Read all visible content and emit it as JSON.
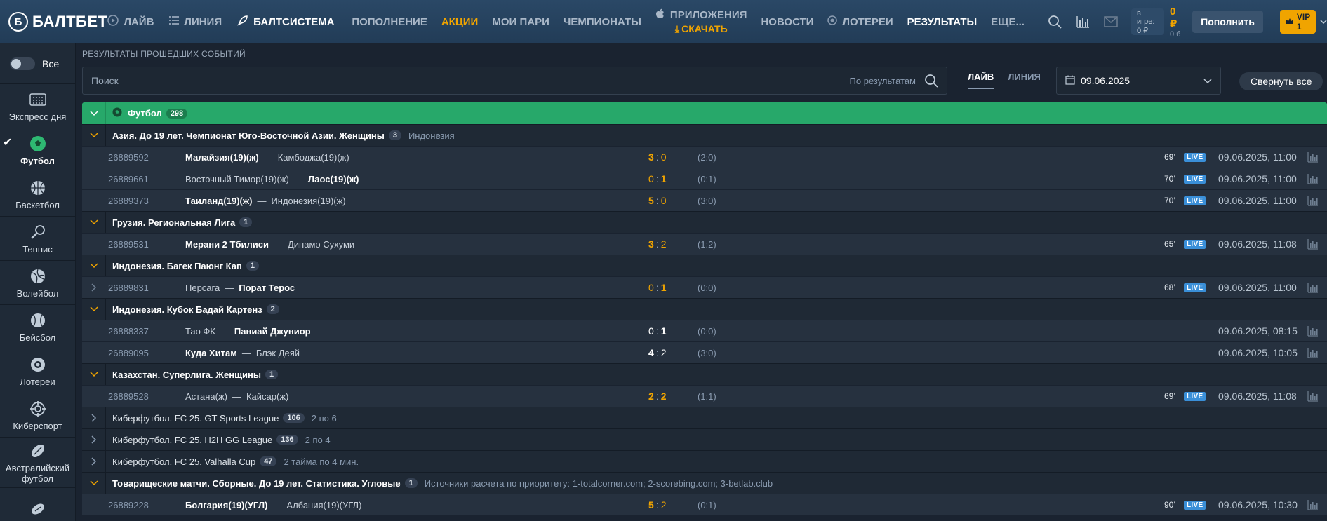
{
  "header": {
    "logo": "БАЛТБЕТ",
    "nav_left": [
      {
        "label": "ЛАЙВ",
        "icon": "play-icon"
      },
      {
        "label": "ЛИНИЯ",
        "icon": "list-icon"
      },
      {
        "label": "БАЛТСИСТЕМА",
        "icon": "rocket-icon"
      }
    ],
    "nav_main": [
      {
        "label": "ПОПОЛНЕНИЕ",
        "accent": false
      },
      {
        "label": "АКЦИИ",
        "accent": true
      },
      {
        "label": "МОИ ПАРИ",
        "accent": false
      },
      {
        "label": "ЧЕМПИОНАТЫ",
        "accent": false
      }
    ],
    "apps": {
      "label": "ПРИЛОЖЕНИЯ",
      "download": "СКАЧАТЬ"
    },
    "nav_extra": [
      {
        "label": "НОВОСТИ"
      },
      {
        "label": "ЛОТЕРЕИ"
      },
      {
        "label": "РЕЗУЛЬТАТЫ"
      },
      {
        "label": "ЕЩЕ..."
      }
    ],
    "wallet": {
      "label": "в игре:",
      "value": "0 ₽"
    },
    "balance": {
      "main": "0 ₽",
      "bonus": "0 б"
    },
    "deposit_label": "Пополнить",
    "vip_label": "VIP 1"
  },
  "sidebar": {
    "toggle_label": "Все",
    "items": [
      {
        "label": "Экспресс дня",
        "icon": "express-icon",
        "active": false
      },
      {
        "label": "Футбол",
        "icon": "football-icon",
        "active": true
      },
      {
        "label": "Баскетбол",
        "icon": "basketball-icon",
        "active": false
      },
      {
        "label": "Теннис",
        "icon": "tennis-icon",
        "active": false
      },
      {
        "label": "Волейбол",
        "icon": "volleyball-icon",
        "active": false
      },
      {
        "label": "Бейсбол",
        "icon": "baseball-icon",
        "active": false
      },
      {
        "label": "Лотереи",
        "icon": "lottery-icon",
        "active": false
      },
      {
        "label": "Киберспорт",
        "icon": "esports-icon",
        "active": false
      },
      {
        "label": "Австралийский футбол",
        "icon": "aussie-football-icon",
        "active": false
      }
    ]
  },
  "main": {
    "caption": "РЕЗУЛЬТАТЫ ПРОШЕДШИХ СОБЫТИЙ",
    "search_placeholder": "Поиск",
    "search_scope": "По результатам",
    "tabs": [
      {
        "label": "ЛАЙВ",
        "active": true
      },
      {
        "label": "ЛИНИЯ",
        "active": false
      }
    ],
    "date": "09.06.2025",
    "collapse_label": "Свернуть все",
    "sport": {
      "name": "Футбол",
      "count": "298"
    }
  },
  "rows": [
    {
      "type": "league",
      "name": "Азия. До 19 лет. Чемпионат Юго-Восточной Азии. Женщины",
      "count": "3",
      "note": "Индонезия",
      "collapsed": false
    },
    {
      "type": "match",
      "id": "26889592",
      "home": "Малайзия(19)(ж)",
      "away": "Камбоджа(19)(ж)",
      "win": "home",
      "s1": "3",
      "s2": "0",
      "half": "(2:0)",
      "minute": "69’",
      "live": true,
      "datetime": "09.06.2025, 11:00",
      "expandable": false
    },
    {
      "type": "match",
      "id": "26889661",
      "home": "Восточный Тимор(19)(ж)",
      "away": "Лаос(19)(ж)",
      "win": "away",
      "s1": "0",
      "s2": "1",
      "half": "(0:1)",
      "minute": "70’",
      "live": true,
      "datetime": "09.06.2025, 11:00",
      "expandable": false
    },
    {
      "type": "match",
      "id": "26889373",
      "home": "Таиланд(19)(ж)",
      "away": "Индонезия(19)(ж)",
      "win": "home",
      "s1": "5",
      "s2": "0",
      "half": "(3:0)",
      "minute": "70’",
      "live": true,
      "datetime": "09.06.2025, 11:00",
      "expandable": false
    },
    {
      "type": "league",
      "name": "Грузия. Региональная Лига",
      "count": "1",
      "note": "",
      "collapsed": false
    },
    {
      "type": "match",
      "id": "26889531",
      "home": "Мерани 2 Тбилиси",
      "away": "Динамо Сухуми",
      "win": "home",
      "s1": "3",
      "s2": "2",
      "half": "(1:2)",
      "minute": "65’",
      "live": true,
      "datetime": "09.06.2025, 11:08",
      "expandable": false
    },
    {
      "type": "league",
      "name": "Индонезия. Багек Паюнг Кап",
      "count": "1",
      "note": "",
      "collapsed": false
    },
    {
      "type": "match",
      "id": "26889831",
      "home": "Персага",
      "away": "Порат Терос",
      "win": "away",
      "s1": "0",
      "s2": "1",
      "half": "(0:0)",
      "minute": "68’",
      "live": true,
      "datetime": "09.06.2025, 11:00",
      "expandable": true
    },
    {
      "type": "league",
      "name": "Индонезия. Кубок Бадай Картенз",
      "count": "2",
      "note": "",
      "collapsed": false
    },
    {
      "type": "match",
      "id": "26888337",
      "home": "Тао ФК",
      "away": "Паниай Джуниор",
      "win": "away",
      "s1": "0",
      "s2": "1",
      "half": "(0:0)",
      "minute": "",
      "live": false,
      "datetime": "09.06.2025, 08:15",
      "expandable": false
    },
    {
      "type": "match",
      "id": "26889095",
      "home": "Куда Хитам",
      "away": "Блэк Деяй",
      "win": "home",
      "s1": "4",
      "s2": "2",
      "half": "(3:0)",
      "minute": "",
      "live": false,
      "datetime": "09.06.2025, 10:05",
      "expandable": false
    },
    {
      "type": "league",
      "name": "Казахстан. Суперлига. Женщины",
      "count": "1",
      "note": "",
      "collapsed": false
    },
    {
      "type": "match",
      "id": "26889528",
      "home": "Астана(ж)",
      "away": "Кайсар(ж)",
      "win": "none",
      "s1": "2",
      "s2": "2",
      "half": "(1:1)",
      "minute": "69’",
      "live": true,
      "datetime": "09.06.2025, 11:08",
      "expandable": false
    },
    {
      "type": "league",
      "name": "Киберфутбол. FC 25. GT Sports League",
      "count": "106",
      "note": "2 по 6",
      "collapsed": true
    },
    {
      "type": "league",
      "name": "Киберфутбол. FC 25. H2H GG League",
      "count": "136",
      "note": "2 по 4",
      "collapsed": true
    },
    {
      "type": "league",
      "name": "Киберфутбол. FC 25. Valhalla Cup",
      "count": "47",
      "note": "2 тайма по 4 мин.",
      "collapsed": true
    },
    {
      "type": "league",
      "name": "Товарищеские матчи. Сборные. До 19 лет. Статистика. Угловые",
      "count": "1",
      "note": "Источники расчета по приоритету: 1-totalcorner.com; 2-scorebing.com; 3-betlab.club",
      "collapsed": false
    },
    {
      "type": "match",
      "id": "26889228",
      "home": "Болгария(19)(УГЛ)",
      "away": "Албания(19)(УГЛ)",
      "win": "home",
      "s1": "5",
      "s2": "2",
      "half": "(0:1)",
      "minute": "90’",
      "live": true,
      "datetime": "09.06.2025, 10:30",
      "expandable": false
    }
  ],
  "live_badge": "LIVE"
}
